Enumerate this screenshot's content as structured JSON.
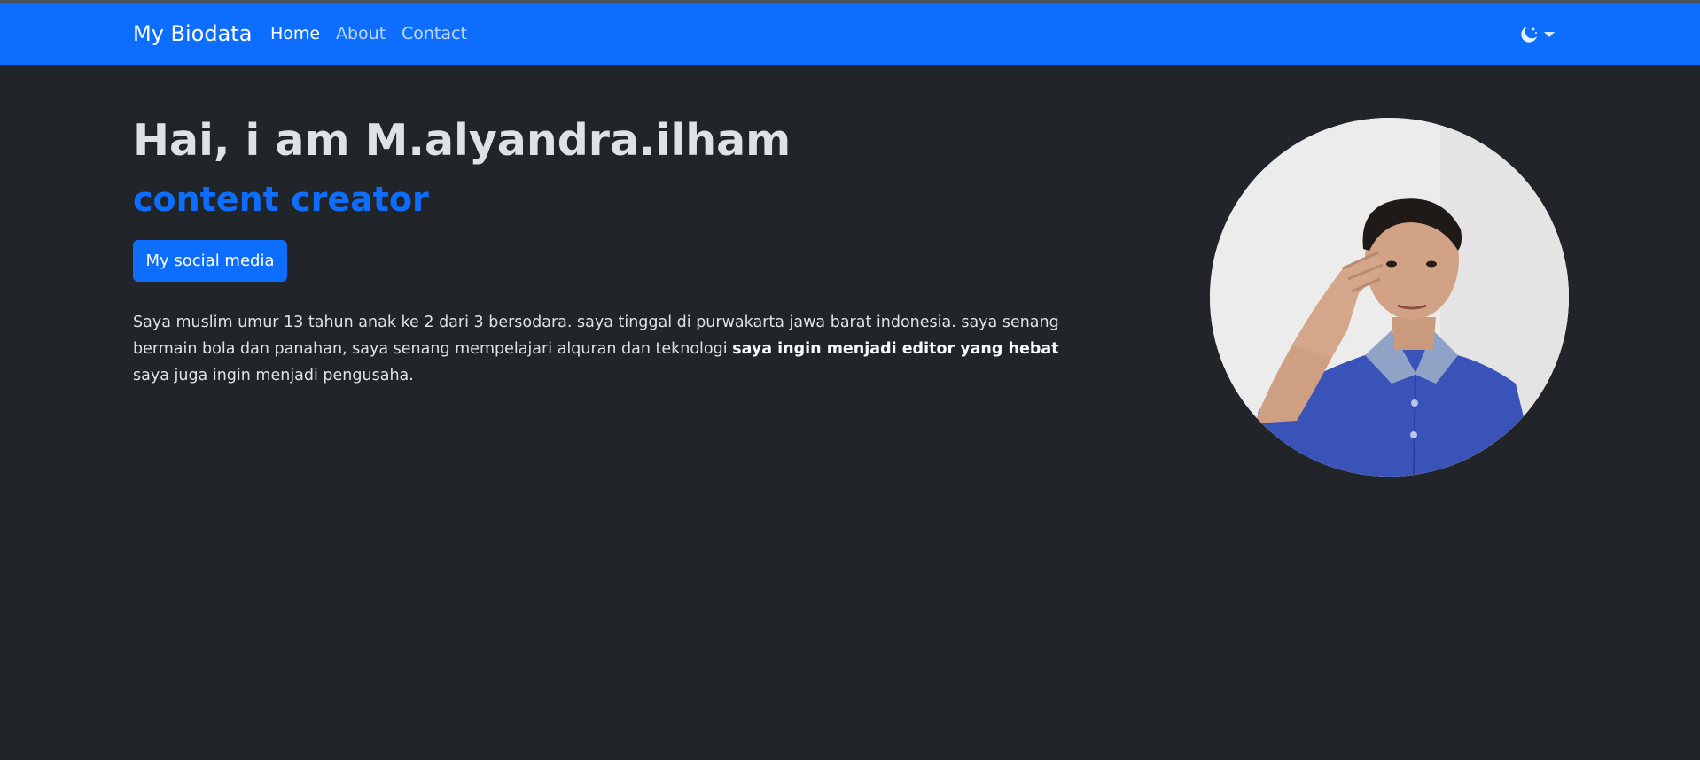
{
  "navbar": {
    "brand": "My Biodata",
    "links": [
      {
        "label": "Home",
        "active": true
      },
      {
        "label": "About",
        "active": false
      },
      {
        "label": "Contact",
        "active": false
      }
    ],
    "theme_icon": "moon-stars-icon",
    "theme_caret_icon": "caret-down-icon",
    "color": "#0d6efd"
  },
  "hero": {
    "title": "Hai, i am M.alyandra.ilham",
    "subtitle": "content creator",
    "button_label": "My social media",
    "bio": {
      "part1": "Saya muslim umur 13 tahun anak ke 2 dari 3 bersodara. saya tinggal di purwakarta jawa barat indonesia. saya senang bermain bola dan panahan, saya senang mempelajari alquran dan teknologi ",
      "emphasis": "saya ingin menjadi editor yang hebat",
      "part2": " saya juga ingin menjadi pengusaha."
    },
    "photo_icon": "profile-photo",
    "accent_color": "#0d6efd"
  },
  "theme": {
    "background": "#212529",
    "text": "#dee2e6"
  }
}
